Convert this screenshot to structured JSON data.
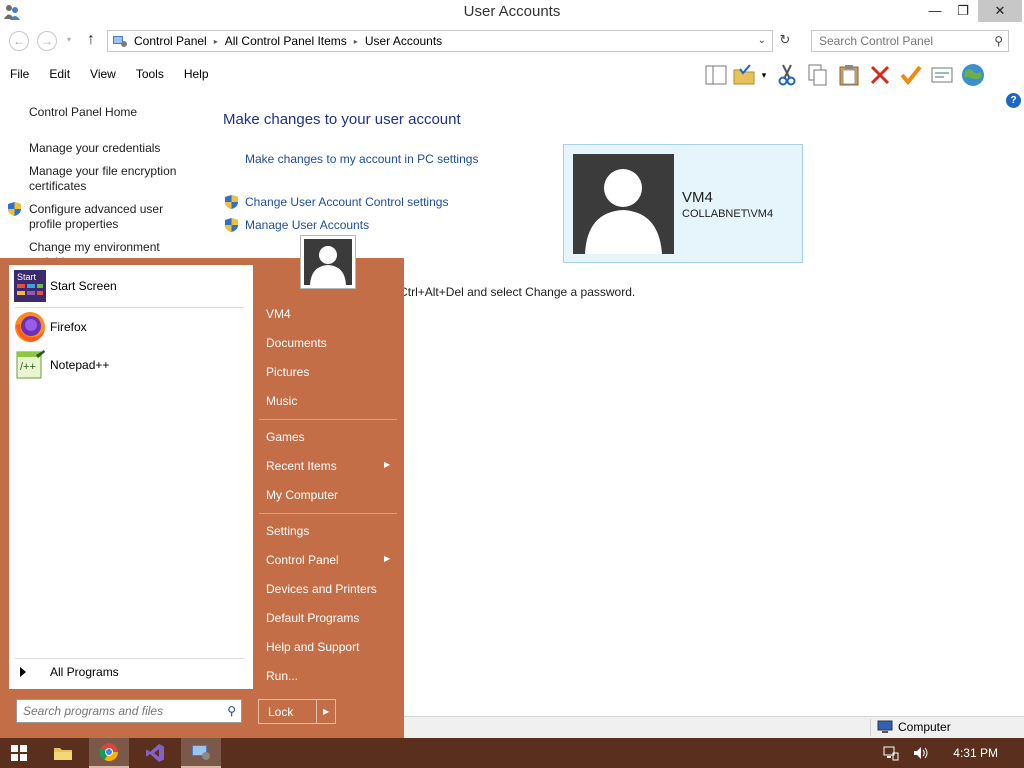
{
  "window": {
    "title": "User Accounts",
    "controls": {
      "minimize": "—",
      "restore": "❐",
      "close": "✕"
    }
  },
  "address": {
    "back": "←",
    "forward": "→",
    "history_dropdown": "▾",
    "up": "↑",
    "crumbs": [
      "Control Panel",
      "All Control Panel Items",
      "User Accounts"
    ],
    "crumb_separator": "▸",
    "dropdown": "⌄",
    "refresh": "↻",
    "search_placeholder": "Search Control Panel",
    "search_icon": "⚲"
  },
  "menubar": {
    "items": [
      "File",
      "Edit",
      "View",
      "Tools",
      "Help"
    ]
  },
  "toolbar": {
    "icons": [
      "preview-pane-icon",
      "folder-check-icon",
      "dropdown-arrow-icon",
      "cut-icon",
      "copy-icon",
      "paste-icon",
      "delete-icon",
      "checkmark-icon",
      "properties-icon",
      "globe-icon"
    ]
  },
  "help_label": "?",
  "leftnav": {
    "home": "Control Panel Home",
    "credentials": "Manage your credentials",
    "encryption": "Manage your file encryption certificates",
    "advanced": "Configure advanced user profile properties",
    "environment": "Change my environment variables"
  },
  "main": {
    "heading": "Make changes to your user account",
    "pc_settings": "Make changes to my account in PC settings",
    "uac": "Change User Account Control settings",
    "manage": "Manage User Accounts",
    "password_note": "To change your password, press Ctrl+Alt+Del and select Change a password."
  },
  "user": {
    "name": "VM4",
    "domain": "COLLABNET\\VM4"
  },
  "status": {
    "computer": "Computer"
  },
  "startmenu": {
    "programs": [
      {
        "label": "Start Screen",
        "icon": "start-screen-icon",
        "badge": "Start"
      },
      {
        "label": "Firefox",
        "icon": "firefox-icon"
      },
      {
        "label": "Notepad++",
        "icon": "notepad-plus-plus-icon"
      }
    ],
    "all_programs": "All Programs",
    "search_placeholder": "Search programs and files",
    "search_icon": "⚲",
    "right_items": [
      {
        "label": "VM4"
      },
      {
        "label": "Documents"
      },
      {
        "label": "Pictures"
      },
      {
        "label": "Music"
      },
      {
        "label": "Games"
      },
      {
        "label": "Recent Items",
        "submenu": true
      },
      {
        "label": "My Computer"
      },
      {
        "label": "Settings"
      },
      {
        "label": "Control Panel",
        "submenu": true
      },
      {
        "label": "Devices and Printers"
      },
      {
        "label": "Default Programs"
      },
      {
        "label": "Help and Support"
      },
      {
        "label": "Run..."
      }
    ],
    "submenu_arrow": "▶",
    "lock": "Lock",
    "lock_arrow": "▶"
  },
  "taskbar": {
    "apps": [
      "file-explorer-icon",
      "chrome-icon",
      "visual-studio-icon",
      "control-panel-icon"
    ],
    "clock": "4:31 PM"
  }
}
